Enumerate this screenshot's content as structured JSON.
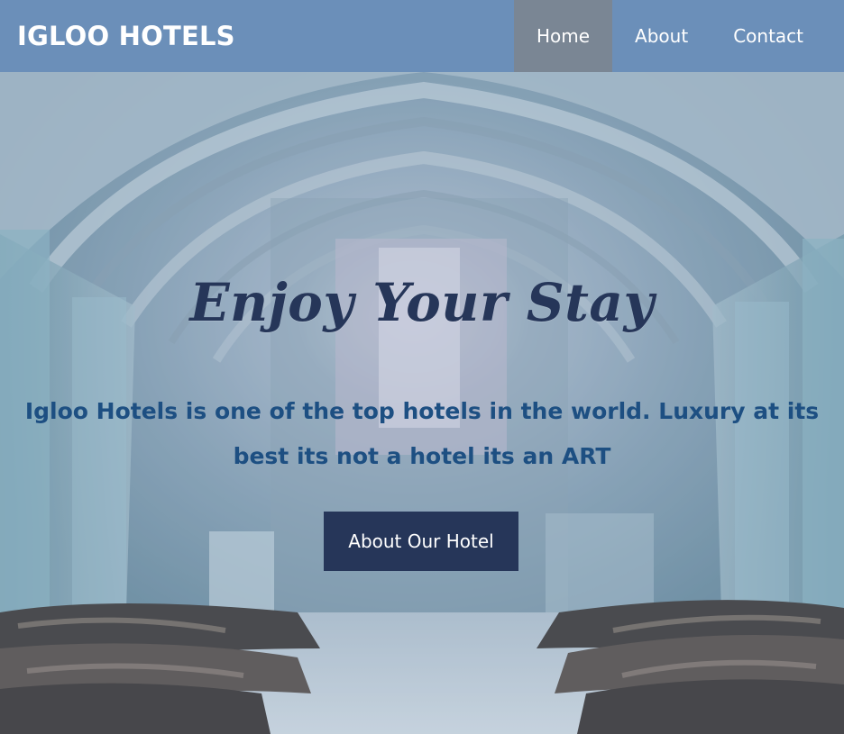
{
  "navbar": {
    "brand": "IGLOO HOTELS",
    "links": [
      {
        "label": "Home",
        "active": true
      },
      {
        "label": "About",
        "active": false
      },
      {
        "label": "Contact",
        "active": false
      }
    ],
    "background": "#6b8fb9",
    "active_background": "#7a8694"
  },
  "hero": {
    "title": "Enjoy Your Stay",
    "description": "Igloo Hotels is one of the top hotels in the world. Luxury at its best its not a hotel its an ART",
    "button_label": "About Our Hotel",
    "title_color": "#263659",
    "description_color": "#1d4f82",
    "button_color": "#263659"
  }
}
